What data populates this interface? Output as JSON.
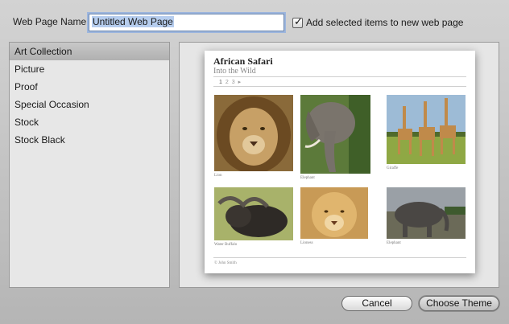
{
  "header": {
    "name_label": "Web Page Name:",
    "name_value": "Untitled Web Page",
    "add_items_label": "Add selected items to new web page",
    "add_items_checked": true
  },
  "themes": [
    {
      "label": "Art Collection",
      "selected": true
    },
    {
      "label": "Picture",
      "selected": false
    },
    {
      "label": "Proof",
      "selected": false
    },
    {
      "label": "Special Occasion",
      "selected": false
    },
    {
      "label": "Stock",
      "selected": false
    },
    {
      "label": "Stock Black",
      "selected": false
    }
  ],
  "preview": {
    "title": "African Safari",
    "subtitle": "Into the Wild",
    "pages": [
      "1",
      "2",
      "3"
    ],
    "next_glyph": "▸",
    "photos": [
      {
        "caption": "Lion",
        "icon": "lion-photo"
      },
      {
        "caption": "Elephant",
        "icon": "elephant-photo"
      },
      {
        "caption": "Giraffe",
        "icon": "giraffe-photo"
      },
      {
        "caption": "Water Buffalo",
        "icon": "buffalo-photo"
      },
      {
        "caption": "Lioness",
        "icon": "lioness-photo"
      },
      {
        "caption": "Elephant",
        "icon": "elephant-photo"
      }
    ],
    "footer": "© John Smith"
  },
  "buttons": {
    "cancel": "Cancel",
    "choose": "Choose Theme"
  },
  "colors": {
    "selection_highlight": "#b6cdee",
    "focus_ring": "#9db6de"
  }
}
